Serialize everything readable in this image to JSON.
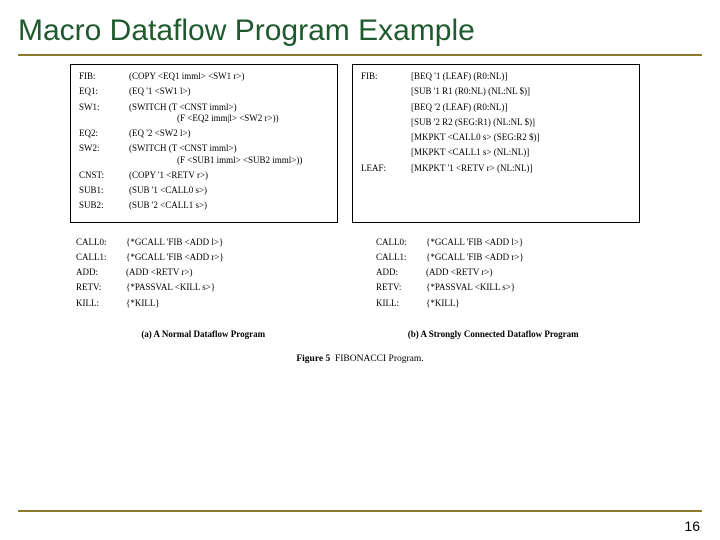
{
  "title": "Macro Dataflow Program Example",
  "page_number": "16",
  "left_box": {
    "fib_lbl": "FIB:",
    "fib": "(COPY  <EQ1 imml> <SW1 r>)",
    "eq1_lbl": "EQ1:",
    "eq1": "(EQ '1 <SW1 l>)",
    "sw1_lbl": "SW1:",
    "sw1a": "(SWITCH (T <CNST imml>)",
    "sw1b": "(F <EQ2 imm|l> <SW2 r>))",
    "eq2_lbl": "EQ2:",
    "eq2": "(EQ '2 <SW2 l>)",
    "sw2_lbl": "SW2:",
    "sw2a": "(SWITCH (T <CNST imml>)",
    "sw2b": "(F <SUB1 imml> <SUB2 imml>))",
    "cnst_lbl": "CNST:",
    "cnst": "(COPY '1 <RETV r>)",
    "sub1_lbl": "SUB1:",
    "sub1": "(SUB '1 <CALL0 s>)",
    "sub2_lbl": "SUB2:",
    "sub2": "(SUB '2 <CALL1 s>)"
  },
  "right_box": {
    "fib_lbl": "FIB:",
    "fib1": "[BEQ '1 (LEAF)  (R0:NL)]",
    "fib2": "[SUB '1 R1 (R0:NL) (NL:NL $)]",
    "fib3": "[BEQ '2 (LEAF)  (R0:NL)]",
    "fib4": "[SUB '2 R2 (SEG:R1) (NL:NL $)]",
    "fib5": "[MKPKT <CALL0 s> (SEG:R2 $)]",
    "fib6": "[MKPKT <CALL1 s> (NL:NL)]",
    "leaf_lbl": "LEAF:",
    "leaf": "[MKPKT '1 <RETV r> (NL:NL)]"
  },
  "lower_left": {
    "call0_lbl": "CALL0:",
    "call0": "{*GCALL 'FIB <ADD l>}",
    "call1_lbl": "CALL1:",
    "call1": "{*GCALL 'FIB <ADD r>}",
    "add_lbl": "ADD:",
    "add": "(ADD <RETV r>)",
    "retv_lbl": "RETV:",
    "retv": "{*PASSVAL <KILL s>}",
    "kill_lbl": "KILL:",
    "kill": "{*KILL}"
  },
  "lower_right": {
    "call0_lbl": "CALL0:",
    "call0": "{*GCALL 'FIB <ADD l>}",
    "call1_lbl": "CALL1:",
    "call1": "{*GCALL 'FIB <ADD r>}",
    "add_lbl": "ADD:",
    "add": "(ADD <RETV r>)",
    "retv_lbl": "RETV:",
    "retv": "{*PASSVAL <KILL s>}",
    "kill_lbl": "KILL:",
    "kill": "{*KILL}"
  },
  "caption_a": "(a) A Normal Dataflow Program",
  "caption_b": "(b) A Strongly Connected Dataflow Program",
  "figure_label": "Figure 5",
  "figure_title": "FIBONACCI Program."
}
